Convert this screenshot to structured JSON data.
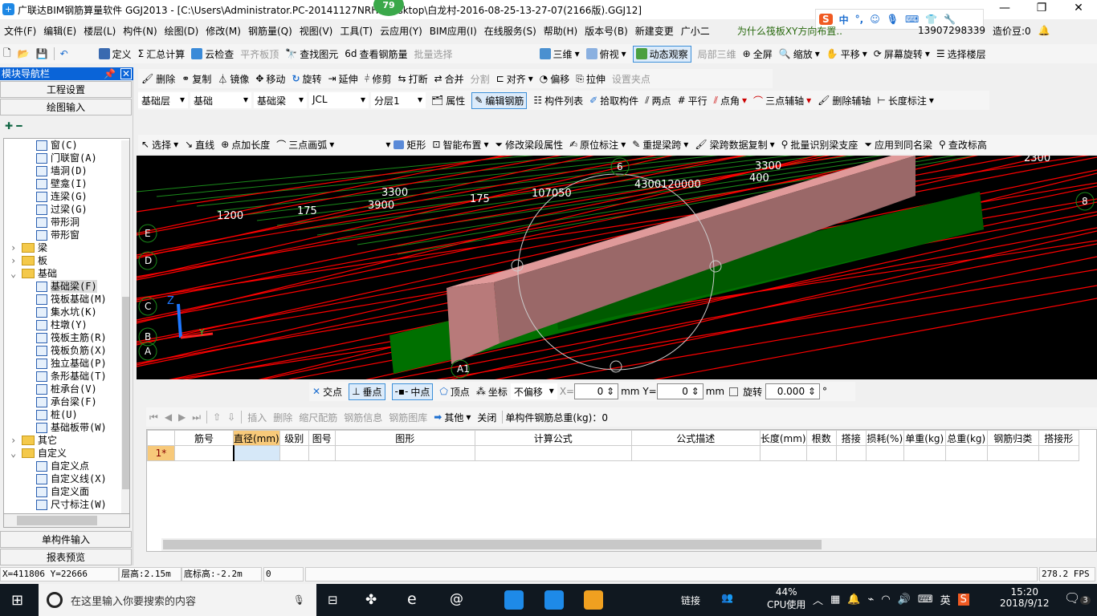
{
  "title": "广联达BIM钢筋算量软件 GGJ2013 - [C:\\Users\\Administrator.PC-20141127NRHI\\Desktop\\白龙村-2016-08-25-13-27-07(2166版).GGJ12]",
  "notification_badge": "79",
  "menu": [
    "文件(F)",
    "编辑(E)",
    "楼层(L)",
    "构件(N)",
    "绘图(D)",
    "修改(M)",
    "钢筋量(Q)",
    "视图(V)",
    "工具(T)",
    "云应用(Y)",
    "BIM应用(I)",
    "在线服务(S)",
    "帮助(H)",
    "版本号(B)",
    "新建变更",
    "广小二"
  ],
  "menu_right": {
    "question": "为什么筏板XY方向布置..",
    "phone": "13907298339",
    "beans": "造价豆:0"
  },
  "ime": {
    "lang": "中"
  },
  "toolbar1": [
    "定义",
    "汇总计算",
    "云检查",
    "平齐板顶",
    "查找图元",
    "查看钢筋量",
    "批量选择",
    "三维",
    "俯视",
    "动态观察",
    "局部三维",
    "全屏",
    "缩放",
    "平移",
    "屏幕旋转",
    "选择楼层"
  ],
  "toolbar2": [
    "删除",
    "复制",
    "镜像",
    "移动",
    "旋转",
    "延伸",
    "修剪",
    "打断",
    "合并",
    "分割",
    "对齐",
    "偏移",
    "拉伸",
    "设置夹点"
  ],
  "selectors": {
    "floor": "基础层",
    "category": "基础",
    "type": "基础梁",
    "name": "JCL",
    "layer": "分层1"
  },
  "toolbar3": [
    "属性",
    "编辑钢筋",
    "构件列表",
    "拾取构件",
    "两点",
    "平行",
    "点角",
    "三点辅轴",
    "删除辅轴",
    "长度标注"
  ],
  "toolbar4": [
    "选择",
    "直线",
    "点加长度",
    "三点画弧",
    "矩形",
    "智能布置",
    "修改梁段属性",
    "原位标注",
    "重提梁跨",
    "梁跨数据复制",
    "批量识别梁支座",
    "应用到同名梁",
    "查改标高"
  ],
  "nav": {
    "header": "模块导航栏",
    "project_settings": "工程设置",
    "drawing_input": "绘图输入",
    "single_input": "单构件输入",
    "report_preview": "报表预览"
  },
  "tree": [
    {
      "label": "窗(C)",
      "level": 2
    },
    {
      "label": "门联窗(A)",
      "level": 2
    },
    {
      "label": "墙洞(D)",
      "level": 2
    },
    {
      "label": "壁龛(I)",
      "level": 2
    },
    {
      "label": "连梁(G)",
      "level": 2
    },
    {
      "label": "过梁(G)",
      "level": 2
    },
    {
      "label": "带形洞",
      "level": 2
    },
    {
      "label": "带形窗",
      "level": 2
    },
    {
      "label": "梁",
      "level": 1,
      "folder": true,
      "expanded": false
    },
    {
      "label": "板",
      "level": 1,
      "folder": true,
      "expanded": false
    },
    {
      "label": "基础",
      "level": 1,
      "folder": true,
      "expanded": true
    },
    {
      "label": "基础梁(F)",
      "level": 2,
      "selected": true
    },
    {
      "label": "筏板基础(M)",
      "level": 2
    },
    {
      "label": "集水坑(K)",
      "level": 2
    },
    {
      "label": "柱墩(Y)",
      "level": 2
    },
    {
      "label": "筏板主筋(R)",
      "level": 2
    },
    {
      "label": "筏板负筋(X)",
      "level": 2
    },
    {
      "label": "独立基础(P)",
      "level": 2
    },
    {
      "label": "条形基础(T)",
      "level": 2
    },
    {
      "label": "桩承台(V)",
      "level": 2
    },
    {
      "label": "承台梁(F)",
      "level": 2
    },
    {
      "label": "桩(U)",
      "level": 2
    },
    {
      "label": "基础板带(W)",
      "level": 2
    },
    {
      "label": "其它",
      "level": 1,
      "folder": true,
      "expanded": false
    },
    {
      "label": "自定义",
      "level": 1,
      "folder": true,
      "expanded": true
    },
    {
      "label": "自定义点",
      "level": 2
    },
    {
      "label": "自定义线(X)",
      "level": 2
    },
    {
      "label": "自定义面",
      "level": 2
    },
    {
      "label": "尺寸标注(W)",
      "level": 2
    }
  ],
  "viewport": {
    "dims": [
      "3300",
      "400",
      "2300",
      "3300",
      "3900",
      "175",
      "107050",
      "4300120000",
      "1200",
      "175"
    ],
    "axes": [
      "6",
      "8",
      "E",
      "D",
      "C",
      "B",
      "A",
      "A1"
    ],
    "axis_labels": [
      "Z",
      "Y"
    ]
  },
  "snap": {
    "items": [
      "交点",
      "垂点",
      "中点",
      "顶点",
      "坐标"
    ],
    "offset": "不偏移",
    "x_label": "X=",
    "x": "0",
    "mm": "mm",
    "y_label": "Y=",
    "y": "0",
    "rotate_label": "旋转",
    "rotate": "0.000",
    "deg": "°"
  },
  "rebar_toolbar": {
    "items": [
      "插入",
      "删除",
      "缩尺配筋",
      "钢筋信息",
      "钢筋图库",
      "其他",
      "关闭"
    ],
    "total": "单构件钢筋总重(kg)：0"
  },
  "table": {
    "columns": [
      "",
      "筋号",
      "直径(mm)",
      "级别",
      "图号",
      "图形",
      "计算公式",
      "公式描述",
      "长度(mm)",
      "根数",
      "搭接",
      "损耗(%)",
      "单重(kg)",
      "总重(kg)",
      "钢筋归类",
      "搭接形"
    ],
    "rows": [
      [
        "1*",
        "",
        "",
        "",
        "",
        "",
        "",
        "",
        "",
        "",
        "",
        "",
        "",
        "",
        "",
        ""
      ]
    ]
  },
  "status": {
    "coords": "X=411806 Y=22666",
    "floor_height": "层高:2.15m",
    "base_elev": "底标高:-2.2m",
    "value": "0",
    "fps": "278.2 FPS"
  },
  "taskbar": {
    "search": "在这里输入你要搜索的内容",
    "link": "链接",
    "cpu": "44%",
    "cpu_label": "CPU使用",
    "lang": "英",
    "time": "15:20",
    "date": "2018/9/12",
    "notif": "3"
  },
  "colors": {
    "nav_header": "#0a64d8",
    "viewport_bg": "#000000",
    "beam_pink": "#e09a9a",
    "foundation_green": "#007000",
    "grid_red": "#ff0000",
    "grid_green": "#1a8a1a"
  }
}
